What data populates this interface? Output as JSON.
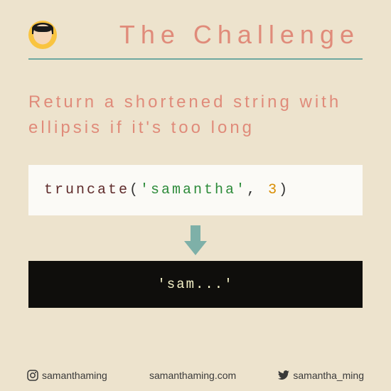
{
  "header": {
    "title": "The Challenge"
  },
  "subtitle": "Return a shortened string with ellipsis if it's too long",
  "code": {
    "fn": "truncate",
    "open": "(",
    "arg1": "'samantha'",
    "comma": ", ",
    "arg2": "3",
    "close": ")"
  },
  "output": "'sam...'",
  "footer": {
    "instagram": "samanthaming",
    "website": "samanthaming.com",
    "twitter": "samantha_ming"
  }
}
